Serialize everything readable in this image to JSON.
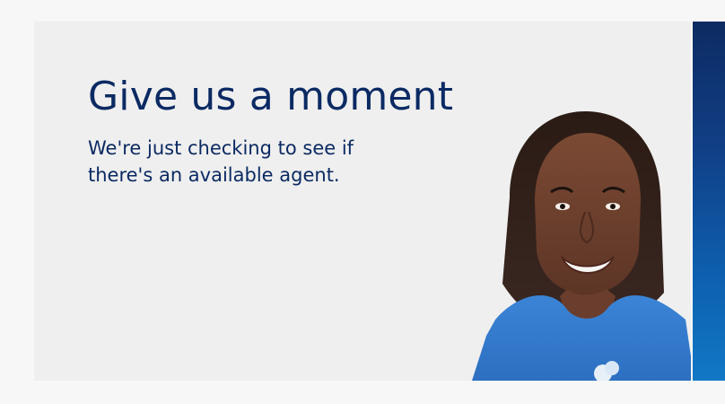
{
  "loading_card": {
    "title": "Give us a moment",
    "message": "We're just checking to see if there's an available agent."
  },
  "colors": {
    "page_background": "#f7f7f7",
    "card_background": "#efefef",
    "text": "#0b2a63",
    "agent_shirt": "#2f76c9",
    "side_panel_top": "#0d2b62",
    "side_panel_bottom": "#1178c6"
  },
  "icons": {
    "agent": "agent-photo"
  }
}
